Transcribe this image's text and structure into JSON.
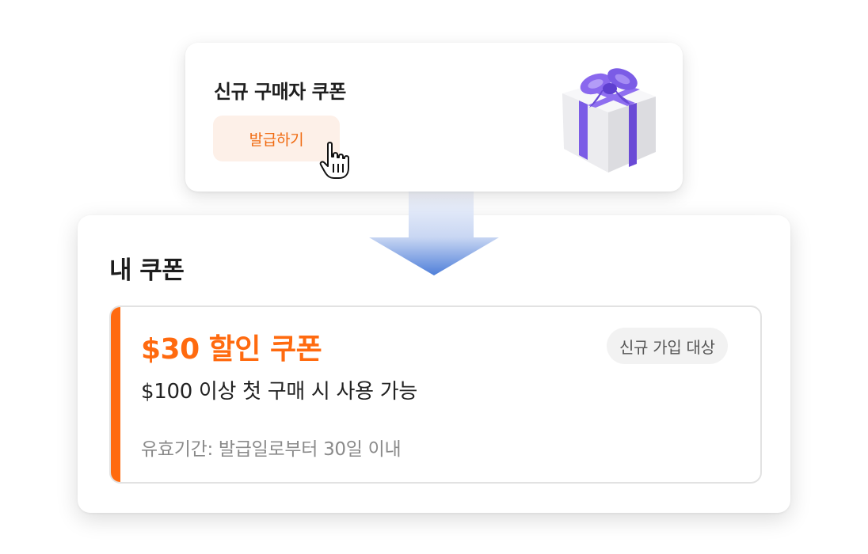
{
  "promo": {
    "title": "신규 구매자 쿠폰",
    "button_label": "발급하기",
    "gift_icon": "gift-box-icon",
    "cursor_icon": "hand-pointer-icon"
  },
  "my_coupons": {
    "title": "내 쿠폰",
    "coupon": {
      "title": "$30 할인 쿠폰",
      "description": "$100 이상 첫 구매 시 사용 가능",
      "validity": "유효기간: 발급일로부터 30일 이내",
      "badge": "신규 가입 대상"
    }
  },
  "colors": {
    "accent": "#ff6a0f",
    "button_bg": "#fdf0e8",
    "ribbon": "#7b5ce6",
    "arrow_top": "#eef2fb",
    "arrow_bottom": "#4f7fd9"
  }
}
